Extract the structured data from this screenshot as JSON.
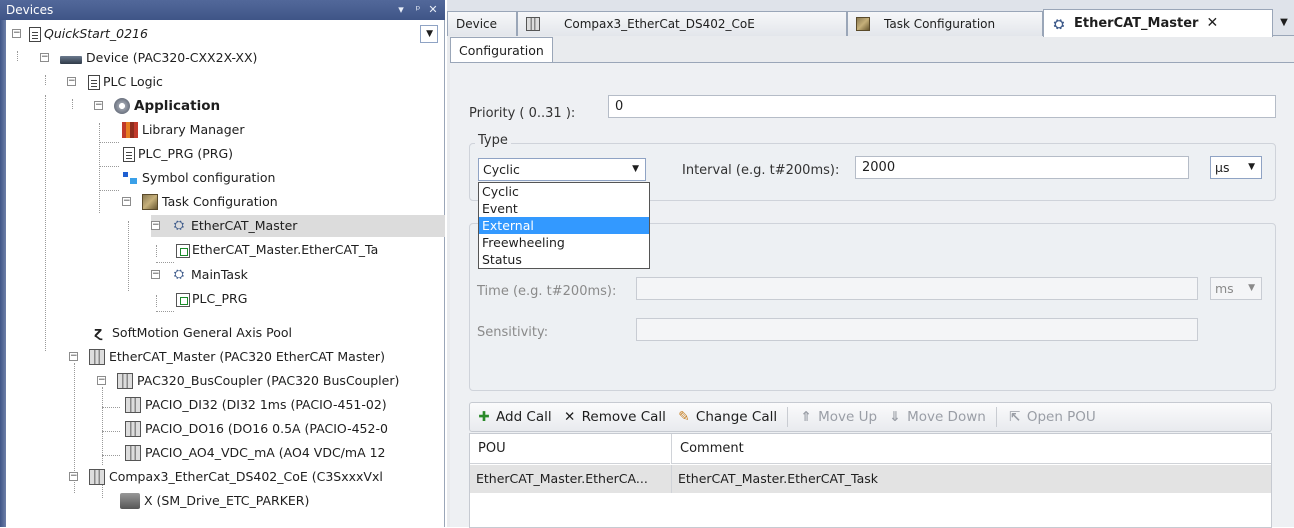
{
  "devices_panel": {
    "title": "Devices",
    "header_buttons": [
      "▾",
      "ᵖ",
      "✕"
    ]
  },
  "tree": [
    {
      "label": "QuickStart_0216",
      "icon": "project-icon",
      "style": "italic"
    },
    {
      "label": "Device (PAC320-CXX2X-XX)",
      "icon": "device-icon"
    },
    {
      "label": "PLC Logic",
      "icon": "plc-logic-icon"
    },
    {
      "label": "Application",
      "icon": "application-gear-icon",
      "style": "bold"
    },
    {
      "label": "Library Manager",
      "icon": "library-manager-icon"
    },
    {
      "label": "PLC_PRG (PRG)",
      "icon": "pou-document-icon"
    },
    {
      "label": "Symbol configuration",
      "icon": "symbol-configuration-icon"
    },
    {
      "label": "Task Configuration",
      "icon": "task-configuration-icon"
    },
    {
      "label": "EtherCAT_Master",
      "icon": "task-icon",
      "selected": true
    },
    {
      "label": "EtherCAT_Master.EtherCAT_Ta",
      "icon": "program-call-icon"
    },
    {
      "label": "MainTask",
      "icon": "task-icon"
    },
    {
      "label": "PLC_PRG",
      "icon": "program-call-icon"
    },
    {
      "label": "SoftMotion General Axis Pool",
      "icon": "axis-pool-icon"
    },
    {
      "label": "EtherCAT_Master (PAC320 EtherCAT Master)",
      "icon": "ethercat-master-icon"
    },
    {
      "label": "PAC320_BusCoupler (PAC320 BusCoupler)",
      "icon": "bus-coupler-icon"
    },
    {
      "label": "PACIO_DI32 (DI32 1ms (PACIO-451-02)",
      "icon": "io-module-icon"
    },
    {
      "label": "PACIO_DO16 (DO16 0.5A (PACIO-452-0",
      "icon": "io-module-icon"
    },
    {
      "label": "PACIO_AO4_VDC_mA (AO4 VDC/mA 12",
      "icon": "io-module-icon"
    },
    {
      "label": "Compax3_EtherCat_DS402_CoE (C3SxxxVxl",
      "icon": "drive-device-icon"
    },
    {
      "label": "X (SM_Drive_ETC_PARKER)",
      "icon": "drive-axis-icon"
    }
  ],
  "tabs": [
    {
      "label": "Device",
      "icon": ""
    },
    {
      "label": "Compax3_EtherCat_DS402_CoE",
      "icon": "device-tab-icon"
    },
    {
      "label": "Task Configuration",
      "icon": "task-configuration-icon"
    },
    {
      "label": "EtherCAT_Master",
      "icon": "task-icon",
      "active": true,
      "close": "✕"
    }
  ],
  "subtab": "Configuration",
  "config": {
    "priority_label": "Priority ( 0..31 ):",
    "priority_value": "0",
    "type_group_title": "Type",
    "type_selected": "Cyclic",
    "type_options": [
      "Cyclic",
      "Event",
      "External",
      "Freewheeling",
      "Status"
    ],
    "type_highlighted": "External",
    "interval_label": "Interval (e.g. t#200ms):",
    "interval_value": "2000",
    "interval_unit": "µs",
    "time_label": "Time (e.g. t#200ms):",
    "time_unit": "ms",
    "sensitivity_label": "Sensitivity:"
  },
  "toolbar": {
    "add_call": "Add Call",
    "remove_call": "Remove Call",
    "change_call": "Change Call",
    "move_up": "Move Up",
    "move_down": "Move Down",
    "open_pou": "Open POU"
  },
  "table": {
    "columns": [
      "POU",
      "Comment"
    ],
    "rows": [
      {
        "pou": "EtherCAT_Master.EtherCA...",
        "comment": "EtherCAT_Master.EtherCAT_Task"
      }
    ]
  },
  "colors": {
    "header_blue": "#3f5587",
    "selection": "#3399ff",
    "row_selected": "#dcdcdc"
  }
}
